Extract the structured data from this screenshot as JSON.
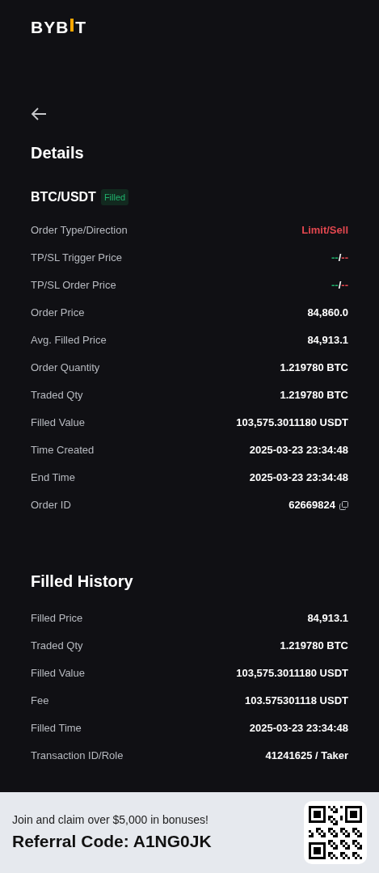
{
  "logo": {
    "left": "BYB",
    "right": "T"
  },
  "title": "Details",
  "pair": {
    "symbol": "BTC/USDT",
    "status": "Filled"
  },
  "details": [
    {
      "kind": "sell",
      "label": "Order Type/Direction",
      "value": "Limit/Sell"
    },
    {
      "kind": "split",
      "label": "TP/SL Trigger Price",
      "take": "--",
      "sep": "/",
      "stop": "--"
    },
    {
      "kind": "split",
      "label": "TP/SL Order Price",
      "take": "--",
      "sep": "/",
      "stop": "--"
    },
    {
      "kind": "text",
      "label": "Order Price",
      "value": "84,860.0"
    },
    {
      "kind": "text",
      "label": "Avg. Filled Price",
      "value": "84,913.1"
    },
    {
      "kind": "text",
      "label": "Order Quantity",
      "value": "1.219780 BTC"
    },
    {
      "kind": "text",
      "label": "Traded Qty",
      "value": "1.219780 BTC"
    },
    {
      "kind": "text",
      "label": "Filled Value",
      "value": "103,575.3011180 USDT"
    },
    {
      "kind": "text",
      "label": "Time Created",
      "value": "2025-03-23 23:34:48"
    },
    {
      "kind": "text",
      "label": "End Time",
      "value": "2025-03-23 23:34:48"
    },
    {
      "kind": "copy",
      "label": "Order ID",
      "value": "62669824"
    }
  ],
  "history_title": "Filled History",
  "history": [
    {
      "kind": "text",
      "label": "Filled Price",
      "value": "84,913.1"
    },
    {
      "kind": "text",
      "label": "Traded Qty",
      "value": "1.219780 BTC"
    },
    {
      "kind": "text",
      "label": "Filled Value",
      "value": "103,575.3011180 USDT"
    },
    {
      "kind": "text",
      "label": "Fee",
      "value": "103.575301118 USDT"
    },
    {
      "kind": "text",
      "label": "Filled Time",
      "value": "2025-03-23 23:34:48"
    },
    {
      "kind": "text",
      "label": "Transaction ID/Role",
      "value": "41241625 / Taker"
    }
  ],
  "banner": {
    "promo": "Join and claim over $5,000 in bonuses!",
    "referral": "Referral Code: A1NG0JK"
  }
}
